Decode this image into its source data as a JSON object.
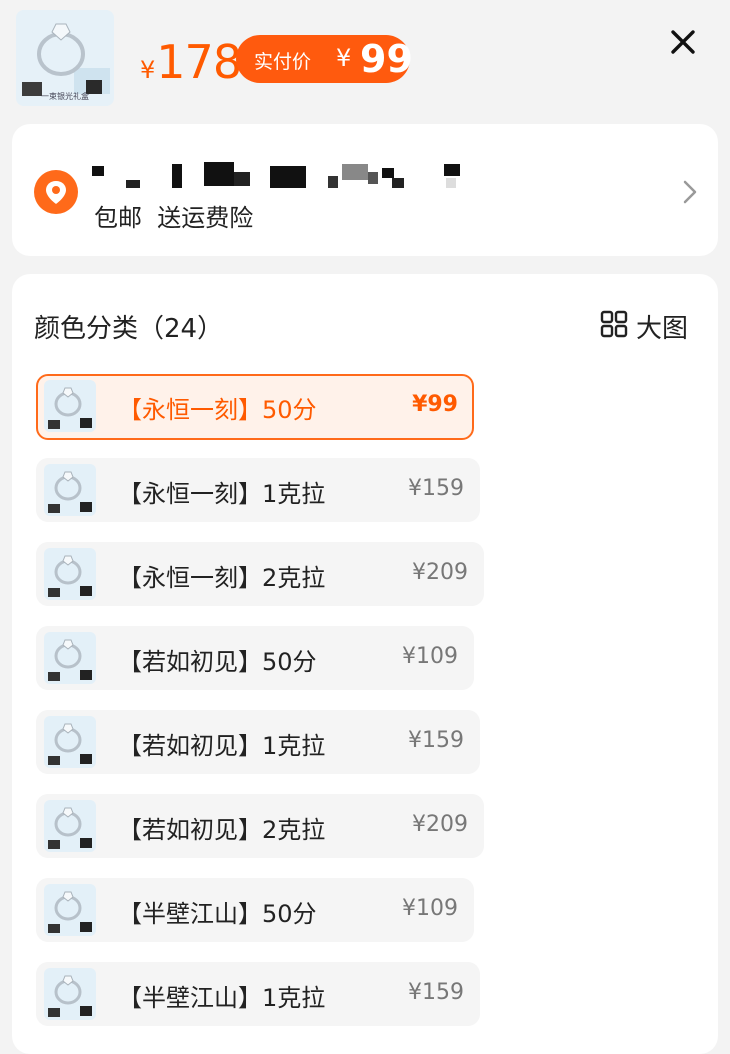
{
  "header": {
    "thumb_caption": "一束银光礼盒",
    "yen_symbol": "¥",
    "original_price": "178",
    "pay_label": "实付价",
    "pay_yen": "¥",
    "pay_price": "99",
    "close_icon": "close-icon"
  },
  "address": {
    "location_icon": "location-pin-icon",
    "tags": "包邮  送运费险",
    "chevron_icon": "chevron-right-icon"
  },
  "variants": {
    "title": "颜色分类（24）",
    "big_view_label": "大图",
    "big_view_icon": "grid-icon",
    "options": [
      {
        "name": "【永恒一刻】50分",
        "price": "¥99",
        "selected": true
      },
      {
        "name": "【永恒一刻】1克拉",
        "price": "¥159",
        "selected": false
      },
      {
        "name": "【永恒一刻】2克拉",
        "price": "¥209",
        "selected": false
      },
      {
        "name": "【若如初见】50分",
        "price": "¥109",
        "selected": false
      },
      {
        "name": "【若如初见】1克拉",
        "price": "¥159",
        "selected": false
      },
      {
        "name": "【若如初见】2克拉",
        "price": "¥209",
        "selected": false
      },
      {
        "name": "【半壁江山】50分",
        "price": "¥109",
        "selected": false
      },
      {
        "name": "【半壁江山】1克拉",
        "price": "¥159",
        "selected": false
      }
    ]
  },
  "colors": {
    "accent": "#ff5a0e",
    "selected_bg": "#fff2ea",
    "option_bg": "#f5f5f5",
    "page_bg": "#f3f3f3"
  }
}
